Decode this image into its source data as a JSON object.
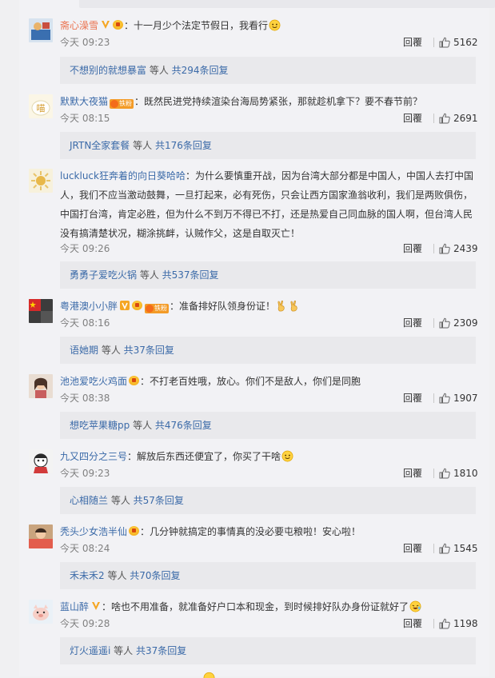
{
  "comments": [
    {
      "username": "斋心澡雪",
      "badges": [
        "v",
        "rank"
      ],
      "content": "：十一月少个法定节假日，我看行",
      "emoji": "smile",
      "time": "今天 09:23",
      "reply_label": "回覆",
      "likes": "5162",
      "sub": {
        "who": "不想别的就想暴富",
        "mid": " 等人 ",
        "total": "共294条回复"
      }
    },
    {
      "username": "默默大夜猫",
      "badges": [
        "fan"
      ],
      "fan_label": "铁粉",
      "content": "：既然民进党持续渲染台海局势紧张，那就趁机拿下？要不春节前？",
      "emoji": "",
      "time": "今天 08:15",
      "reply_label": "回覆",
      "likes": "2691",
      "sub": {
        "who": "JRTN全家套餐",
        "mid": " 等人 ",
        "total": "共176条回复"
      }
    },
    {
      "username": "luckluck狂奔着的向日葵哈哈",
      "badges": [],
      "content": "：为什么要慎重开战，因为台湾大部分都是中国人，中国人去打中国人，我们不应当激动鼓舞，一旦打起来，必有死伤，只会让西方国家渔翁收利，我们是两败俱伤，中国打台湾，肯定必胜，但为什么不到万不得已不打，还是热爱自己同血脉的国人啊，但台湾人民没有搞清楚状况，糊涂挑衅，认贼作父，这是自取灭亡！",
      "line2": "人，我们不应当激动鼓舞，一旦打起来，必有死伤，只会让西方国家渔翁收利，我们是两败俱伤，",
      "line3": "中国打台湾，肯定必胜，但为什么不到万不得已不打，还是热爱自己同血脉的国人啊，但台湾人民",
      "line4": "没有搞清楚状况，糊涂挑衅，认贼作父，这是自取灭亡！",
      "line1": "：为什么要慎重开战，因为台湾大部分都是中国人，中国人去打中国",
      "time": "今天 09:26",
      "reply_label": "回覆",
      "likes": "2439",
      "sub": {
        "who": "勇勇子爱吃火锅",
        "mid": " 等人 ",
        "total": "共537条回复"
      }
    },
    {
      "username": "粤港澳小小胖",
      "badges": [
        "v",
        "rank",
        "fan"
      ],
      "fan_label": "铁粉",
      "content": "：准备排好队领身份证！",
      "emoji": "victory",
      "time": "今天 08:16",
      "reply_label": "回覆",
      "likes": "2309",
      "sub": {
        "who": "语她期",
        "mid": " 等人 ",
        "total": "共37条回复"
      }
    },
    {
      "username": "池池爱吃火鸡面",
      "badges": [
        "rank"
      ],
      "content": "：不打老百姓哦，放心。你们不是敌人，你们是同胞",
      "emoji": "",
      "time": "今天 08:38",
      "reply_label": "回覆",
      "likes": "1907",
      "sub": {
        "who": "想吃苹果糖pp",
        "mid": " 等人 ",
        "total": "共476条回复"
      }
    },
    {
      "username": "九又四分之三号",
      "badges": [],
      "content": "：解放后东西还便宜了，你买了干啥",
      "emoji": "smile",
      "time": "今天 09:23",
      "reply_label": "回覆",
      "likes": "1810",
      "sub": {
        "who": "心相随兰",
        "mid": " 等人 ",
        "total": "共57条回复"
      }
    },
    {
      "username": "秃头少女浩半仙",
      "badges": [
        "rank"
      ],
      "content": "：几分钟就搞定的事情真的没必要屯粮啦！安心啦！",
      "emoji": "",
      "time": "今天 08:24",
      "reply_label": "回覆",
      "likes": "1545",
      "sub": {
        "who": "禾未禾2",
        "mid": " 等人 ",
        "total": "共70条回复"
      }
    },
    {
      "username": "蓝山醉",
      "badges": [
        "v"
      ],
      "content": "：啥也不用准备，就准备好户口本和现金，到时候排好队办身份证就好了",
      "emoji": "laugh",
      "time": "今天 09:28",
      "reply_label": "回覆",
      "likes": "1198",
      "sub": {
        "who": "灯火遥遥i",
        "mid": " 等人 ",
        "total": "共37条回复"
      }
    }
  ],
  "colors": {
    "username": "#eb7350",
    "link": "#3b6aa8",
    "panel": "#f2f2f5",
    "subreply_bg": "#e9e9ec"
  }
}
